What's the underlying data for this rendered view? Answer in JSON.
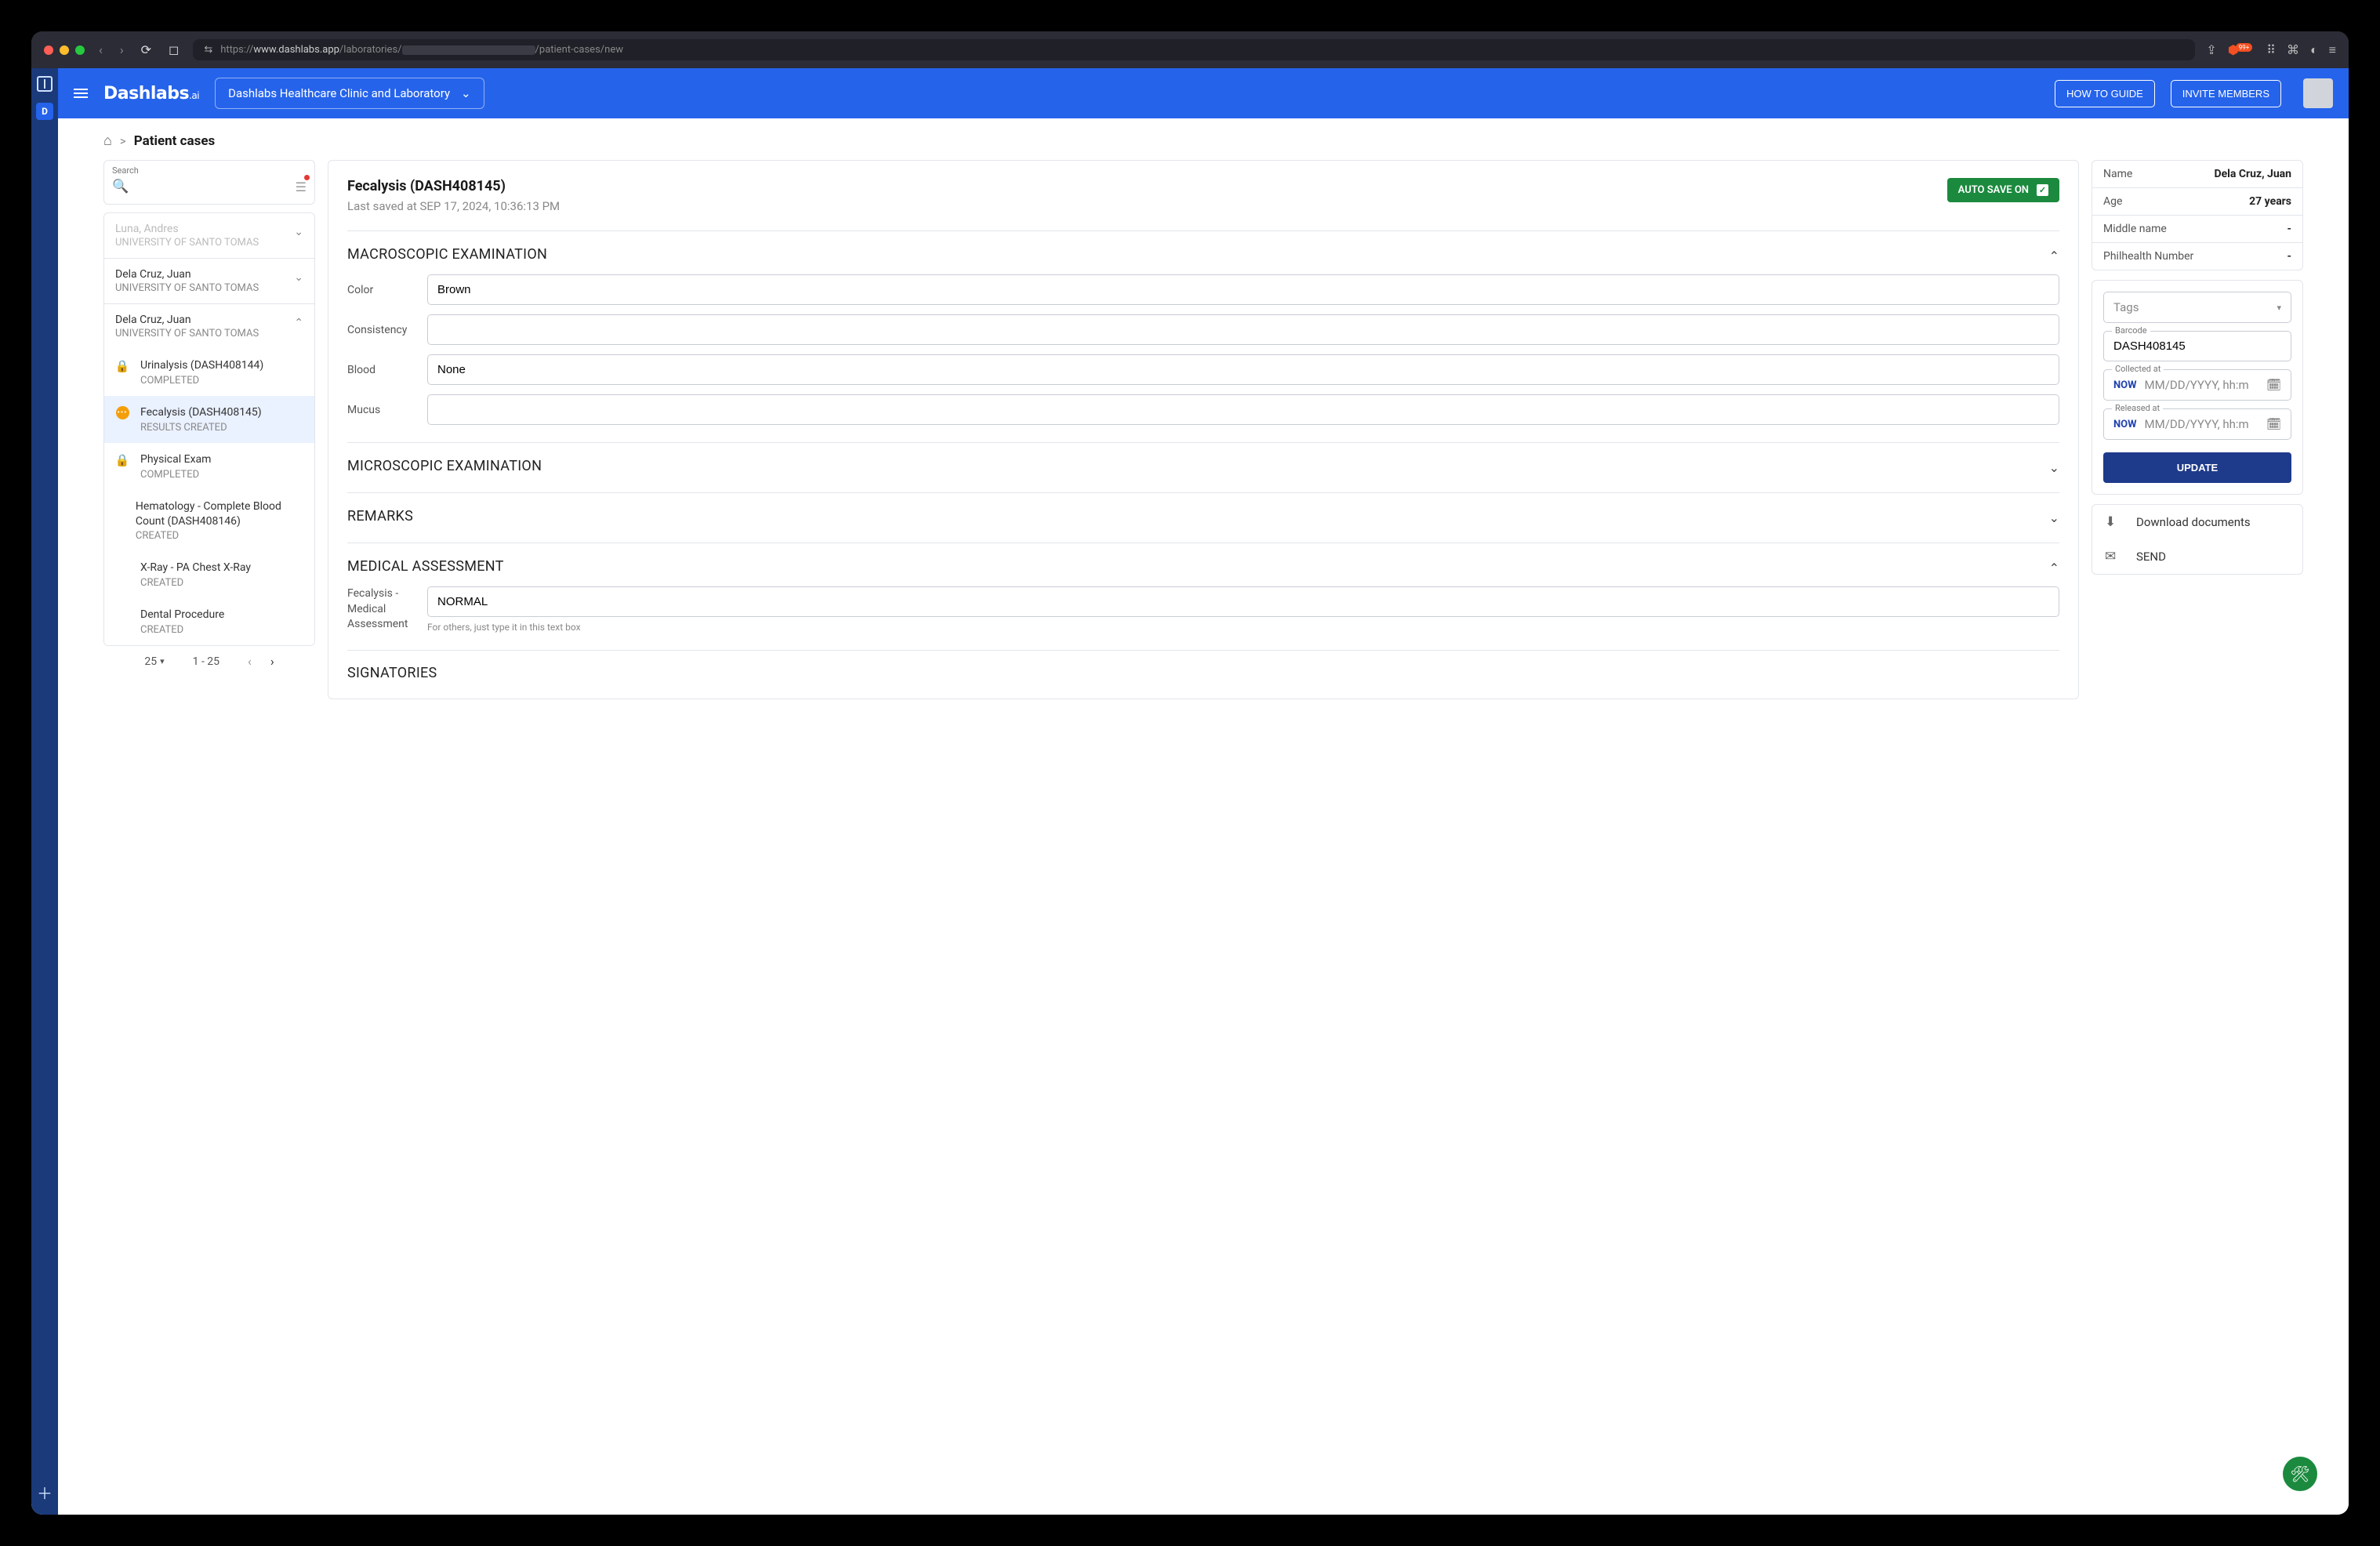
{
  "browser": {
    "url_prefix": "https://",
    "url_host": "www.dashlabs.app",
    "url_path_a": "/laboratories/",
    "url_path_b": "/patient-cases/new",
    "badge": "99+"
  },
  "header": {
    "brand": "Dashlabs",
    "brand_suffix": ".ai",
    "org": "Dashlabs Healthcare Clinic and Laboratory",
    "how_to": "HOW TO GUIDE",
    "invite": "INVITE MEMBERS"
  },
  "breadcrumbs": {
    "current": "Patient cases"
  },
  "left": {
    "search_label": "Search",
    "patients": [
      {
        "name": "Luna, Andres",
        "inst": "UNIVERSITY OF SANTO TOMAS",
        "expanded": false,
        "faded": true
      },
      {
        "name": "Dela Cruz, Juan",
        "inst": "UNIVERSITY OF SANTO TOMAS",
        "expanded": false,
        "faded": false
      },
      {
        "name": "Dela Cruz, Juan",
        "inst": "UNIVERSITY OF SANTO TOMAS",
        "expanded": true,
        "faded": false
      }
    ],
    "tests": [
      {
        "icon": "lock",
        "title": "Urinalysis (DASH408144)",
        "status": "COMPLETED",
        "active": false
      },
      {
        "icon": "dots",
        "title": "Fecalysis (DASH408145)",
        "status": "RESULTS CREATED",
        "active": true
      },
      {
        "icon": "lock",
        "title": "Physical Exam",
        "status": "COMPLETED",
        "active": false
      },
      {
        "icon": "",
        "title": "Hematology - Complete Blood Count (DASH408146)",
        "status": "CREATED",
        "active": false
      },
      {
        "icon": "",
        "title": "X-Ray - PA Chest X-Ray",
        "status": "CREATED",
        "active": false
      },
      {
        "icon": "",
        "title": "Dental Procedure",
        "status": "CREATED",
        "active": false
      }
    ],
    "pager_per": "25",
    "pager_range": "1 - 25"
  },
  "main": {
    "title": "Fecalysis (DASH408145)",
    "saved": "Last saved at SEP 17, 2024, 10:36:13 PM",
    "autosave": "AUTO SAVE ON",
    "sections": {
      "macro": {
        "title": "MACROSCOPIC EXAMINATION",
        "open": true
      },
      "micro": {
        "title": "MICROSCOPIC EXAMINATION",
        "open": false
      },
      "remarks": {
        "title": "REMARKS",
        "open": false
      },
      "assess": {
        "title": "MEDICAL ASSESSMENT",
        "open": true
      },
      "sig": {
        "title": "SIGNATORIES",
        "open": false
      }
    },
    "macro_fields": {
      "color_label": "Color",
      "color_value": "Brown",
      "consistency_label": "Consistency",
      "consistency_value": "",
      "blood_label": "Blood",
      "blood_value": "None",
      "mucus_label": "Mucus",
      "mucus_value": ""
    },
    "assess_fields": {
      "label": "Fecalysis - Medical Assessment",
      "value": "NORMAL",
      "helper": "For others, just type it in this text box"
    }
  },
  "right": {
    "info": [
      {
        "k": "Name",
        "v": "Dela Cruz, Juan"
      },
      {
        "k": "Age",
        "v": "27 years"
      },
      {
        "k": "Middle name",
        "v": "-"
      },
      {
        "k": "Philhealth Number",
        "v": "-"
      }
    ],
    "tags_placeholder": "Tags",
    "barcode_label": "Barcode",
    "barcode_value": "DASH408145",
    "collected_label": "Collected at",
    "released_label": "Released at",
    "now": "NOW",
    "dt_placeholder": "MM/DD/YYYY, hh:m",
    "update": "UPDATE",
    "actions": [
      {
        "icon": "⬇",
        "label": "Download documents"
      },
      {
        "icon": "✉",
        "label": "SEND"
      }
    ]
  }
}
